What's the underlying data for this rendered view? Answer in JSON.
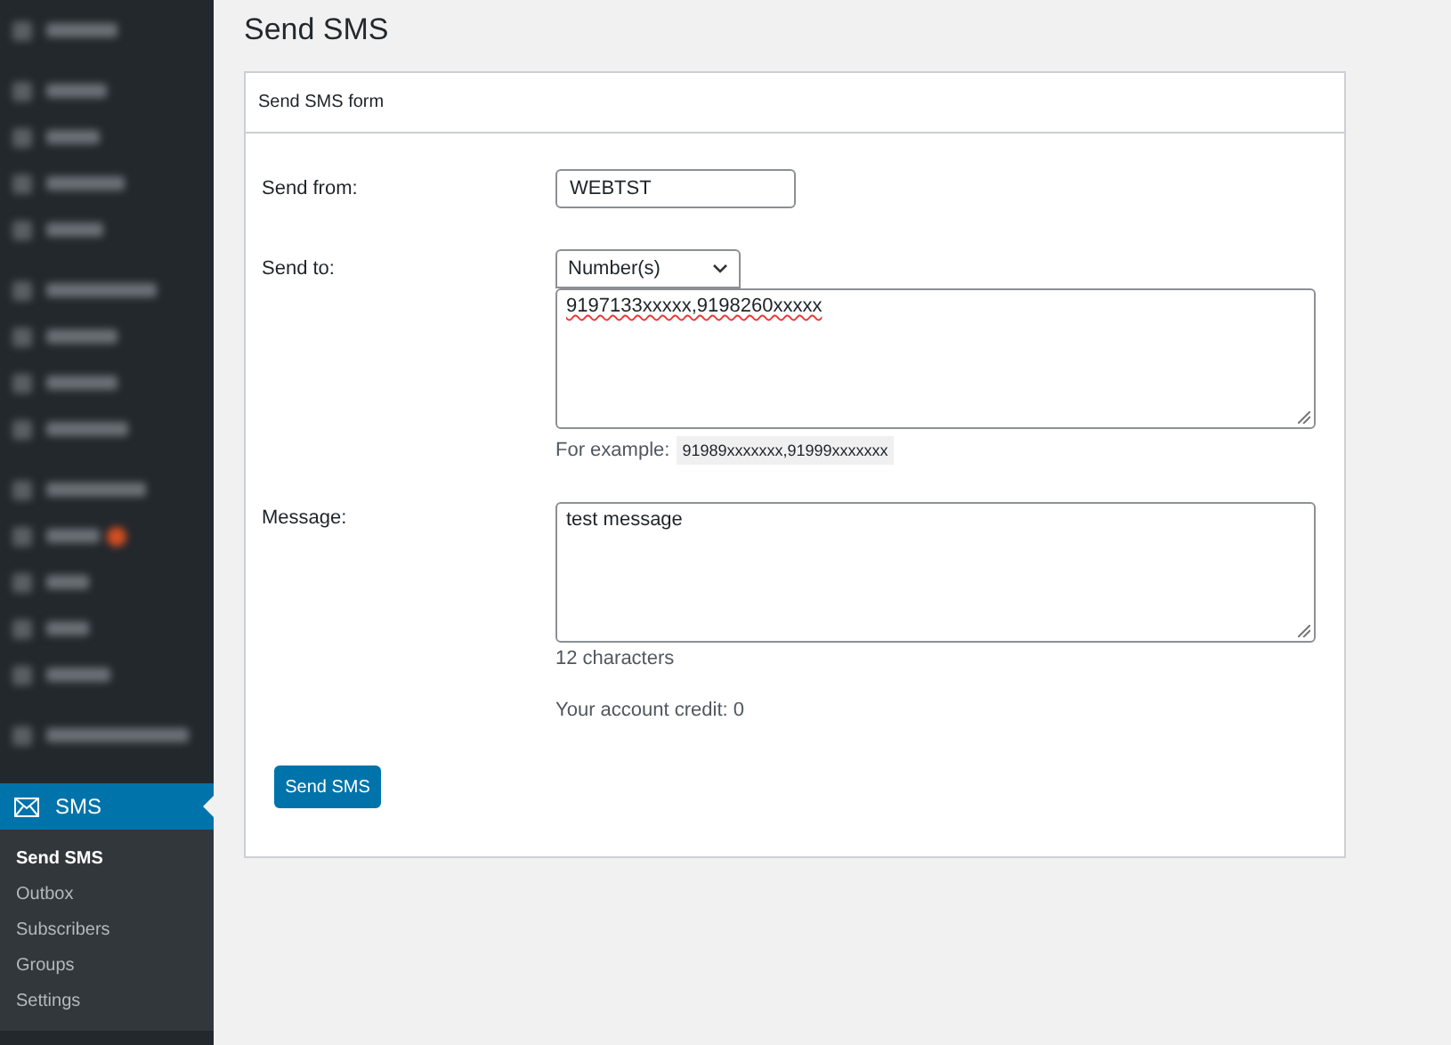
{
  "sidebar": {
    "active_menu": {
      "label": "SMS",
      "selected": true
    },
    "submenu": [
      {
        "label": "Send SMS",
        "selected": true
      },
      {
        "label": "Outbox",
        "selected": false
      },
      {
        "label": "Subscribers",
        "selected": false
      },
      {
        "label": "Groups",
        "selected": false
      },
      {
        "label": "Settings",
        "selected": false
      }
    ]
  },
  "page_title": "Send SMS",
  "form": {
    "title": "Send SMS form",
    "send_from": {
      "label": "Send from:",
      "value": "WEBTST"
    },
    "send_to": {
      "label": "Send to:",
      "select": "Number(s)",
      "value": "9197133xxxxx,9198260xxxxx",
      "example_label": "For example:",
      "example": "91989xxxxxxx,91999xxxxxxx"
    },
    "message": {
      "label": "Message:",
      "value": "test message",
      "count": "12 characters"
    },
    "credit": "Your account credit: 0",
    "button": "Send SMS"
  }
}
